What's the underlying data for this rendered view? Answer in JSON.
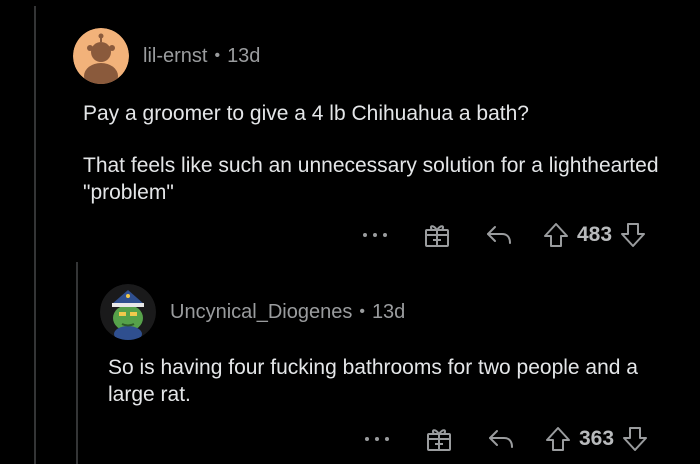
{
  "comments": [
    {
      "username": "lil-ernst",
      "separator": "•",
      "time": "13d",
      "paragraphs": [
        "Pay a groomer to give a 4 lb Chihuahua a bath?",
        "That feels like such an unnecessary solution for a lighthearted \"problem\""
      ],
      "score": "483",
      "avatar_colors": {
        "bg": "#f2b27a",
        "figure": "#8a5a3c"
      }
    },
    {
      "username": "Uncynical_Diogenes",
      "separator": "•",
      "time": "13d",
      "paragraphs": [
        "So is having four fucking bathrooms for two people and a large rat."
      ],
      "score": "363",
      "avatar_colors": {
        "bg": "#1a1a1b",
        "figure": "#56a14a",
        "hat": "#2f4f8f"
      }
    }
  ],
  "icons": {
    "more": "more-options-icon",
    "award": "award-icon",
    "reply": "reply-icon",
    "upvote": "upvote-arrow-icon",
    "downvote": "downvote-arrow-icon"
  },
  "colors": {
    "background": "#000000",
    "text": "#e4e6e8",
    "meta": "#9a9c9e",
    "thread_line": "#343536"
  }
}
